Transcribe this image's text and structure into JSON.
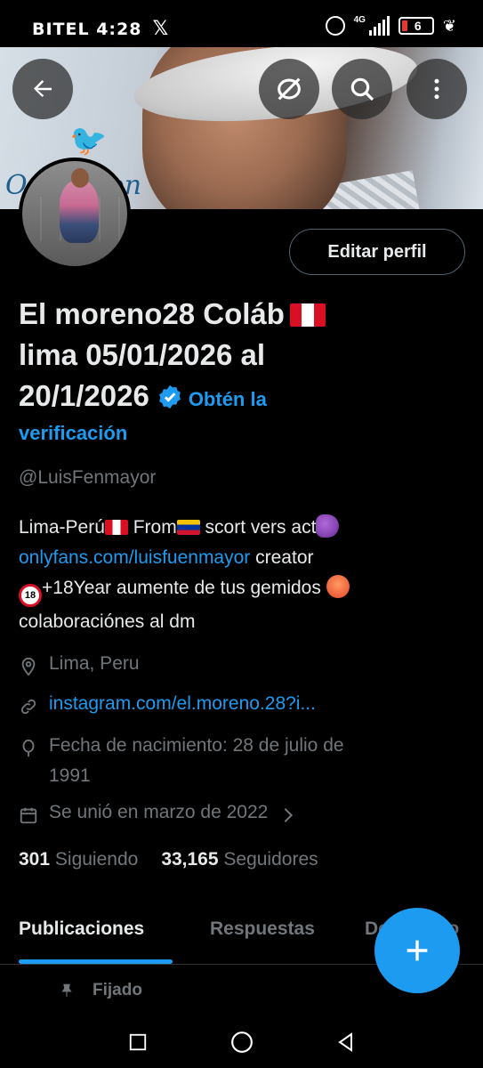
{
  "status_bar": {
    "carrier_time": "BITEL 4:28",
    "x_icon": "x-logo-icon",
    "network_label": "4G",
    "battery_level": "6",
    "battery_color": "#e53935"
  },
  "header": {
    "back_icon": "arrow-left-icon",
    "hide_icon": "eye-off-icon",
    "search_icon": "search-icon",
    "more_icon": "more-vertical-icon"
  },
  "banner": {
    "script_text": "On   ashion"
  },
  "profile": {
    "edit_label": "Editar perfil",
    "name_line1": "El moreno28 Coláb",
    "name_line2": "lima 05/01/2026 al",
    "name_line3": "20/1/2026",
    "verify_part1": "Obtén la",
    "verify_part2": "verificación",
    "handle": "@LuisFenmayor",
    "bio": {
      "line1_a": "Lima-Perú",
      "line1_b": " From",
      "line1_c": " scort vers act",
      "link": "onlyfans.com/luisfuenmayor",
      "line2_b": "  creator",
      "line3_b": "+18Year   aumente de tus gemidos ",
      "line4": "colaboraciónes al dm"
    },
    "location": "Lima, Peru",
    "website": "instagram.com/el.moreno.28?i...",
    "birth_line1": "Fecha de nacimiento: 28 de julio de",
    "birth_line2": "1991",
    "joined": "Se unió en marzo de 2022",
    "following_count": "301",
    "following_label": "Siguiendo",
    "followers_count": "33,165",
    "followers_label": "Seguidores"
  },
  "tabs": {
    "items": [
      {
        "label": "Publicaciones",
        "active": true
      },
      {
        "label": "Respuestas",
        "active": false
      },
      {
        "label": "Destacado",
        "active": false
      }
    ]
  },
  "fab_icon": "plus-icon",
  "pinned_label": "Fijado",
  "colors": {
    "accent": "#1d9bf0",
    "text": "#e7e9ea",
    "muted": "#71767b",
    "background": "#000000"
  }
}
